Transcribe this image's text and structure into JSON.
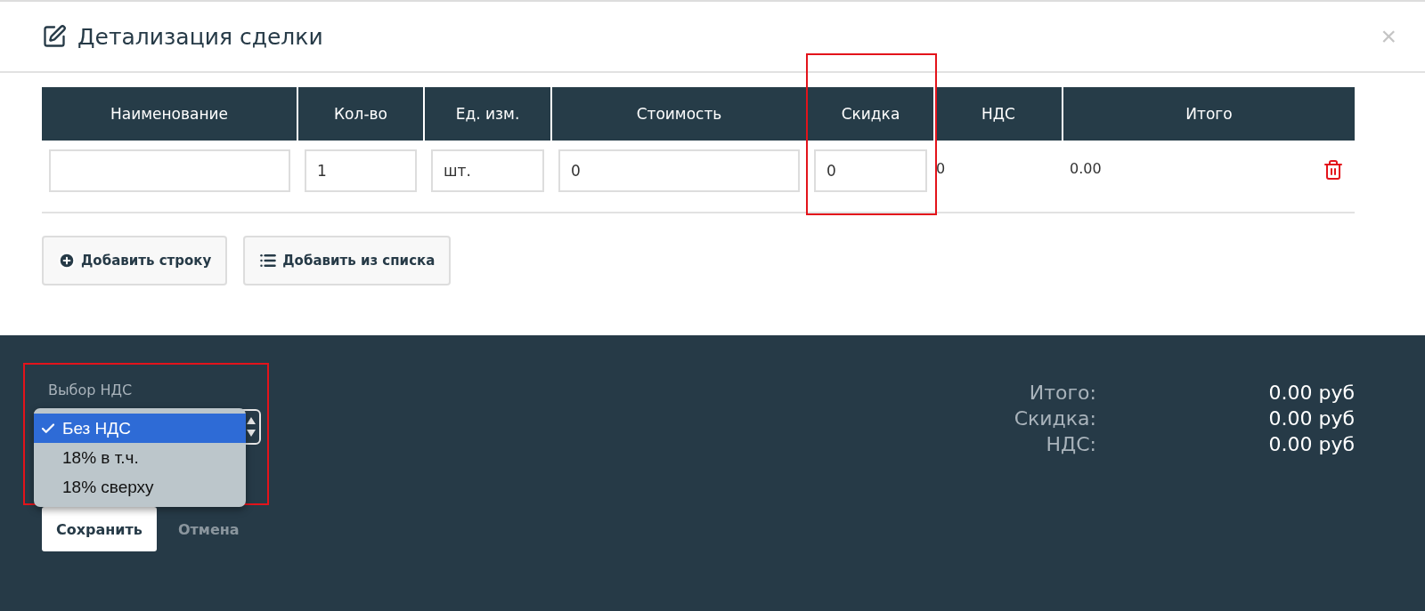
{
  "dialog": {
    "title": "Детализация сделки",
    "close": "×"
  },
  "table": {
    "columns": [
      "Наименование",
      "Кол-во",
      "Ед. изм.",
      "Стоимость",
      "Скидка",
      "НДС",
      "Итого"
    ],
    "rows": [
      {
        "name": "",
        "qty": "1",
        "unit": "шт.",
        "price": "0",
        "discount": "0",
        "vat": "0",
        "total": "0.00",
        "highlighted_discount": true
      }
    ]
  },
  "actions": [
    {
      "kind": "add",
      "label": "Добавить строку"
    },
    {
      "kind": "list",
      "label": "Добавить из списка"
    }
  ],
  "vat_select": {
    "label": "Выбор НДС",
    "expanded": true,
    "highlighted": true,
    "options": [
      {
        "label": "Без НДС",
        "selected": true
      },
      {
        "label": "18% в т.ч.",
        "selected": false
      },
      {
        "label": "18% сверху",
        "selected": false
      }
    ]
  },
  "footer_buttons": [
    {
      "kind": "primary",
      "label": "Сохранить"
    },
    {
      "kind": "link",
      "label": "Отмена"
    }
  ],
  "totals": [
    {
      "label": "Итого:",
      "value": "0.00 руб"
    },
    {
      "label": "Скидка:",
      "value": "0.00 руб"
    },
    {
      "label": "НДС:",
      "value": "0.00 руб"
    }
  ]
}
